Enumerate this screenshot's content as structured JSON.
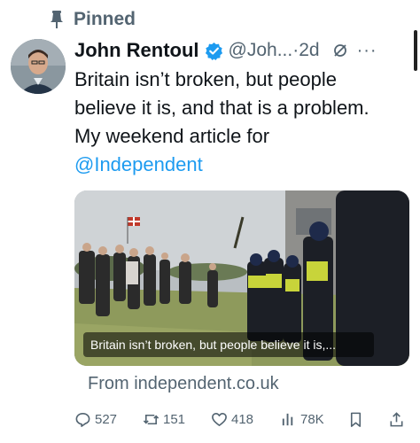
{
  "pinned": {
    "label": "Pinned",
    "icon": "pin-icon"
  },
  "author": {
    "name": "John Rentoul",
    "handle": "@Joh...",
    "separator": " · ",
    "time": "2d",
    "verified_icon": "verified-badge-icon",
    "verified_color": "#1d9bf0"
  },
  "tweet": {
    "lines": [
      "Britain isn’t broken, but people",
      "believe it is, and that is a problem.",
      "My weekend article for"
    ],
    "mention": "@Independent"
  },
  "card": {
    "caption": "Britain isn’t broken, but people believe it is,...",
    "source": "From independent.co.uk"
  },
  "actions": {
    "replies": "527",
    "reposts": "151",
    "likes": "418",
    "views": "78K"
  },
  "colors": {
    "accent": "#1d9bf0",
    "muted": "#536471",
    "text": "#0f1419"
  }
}
